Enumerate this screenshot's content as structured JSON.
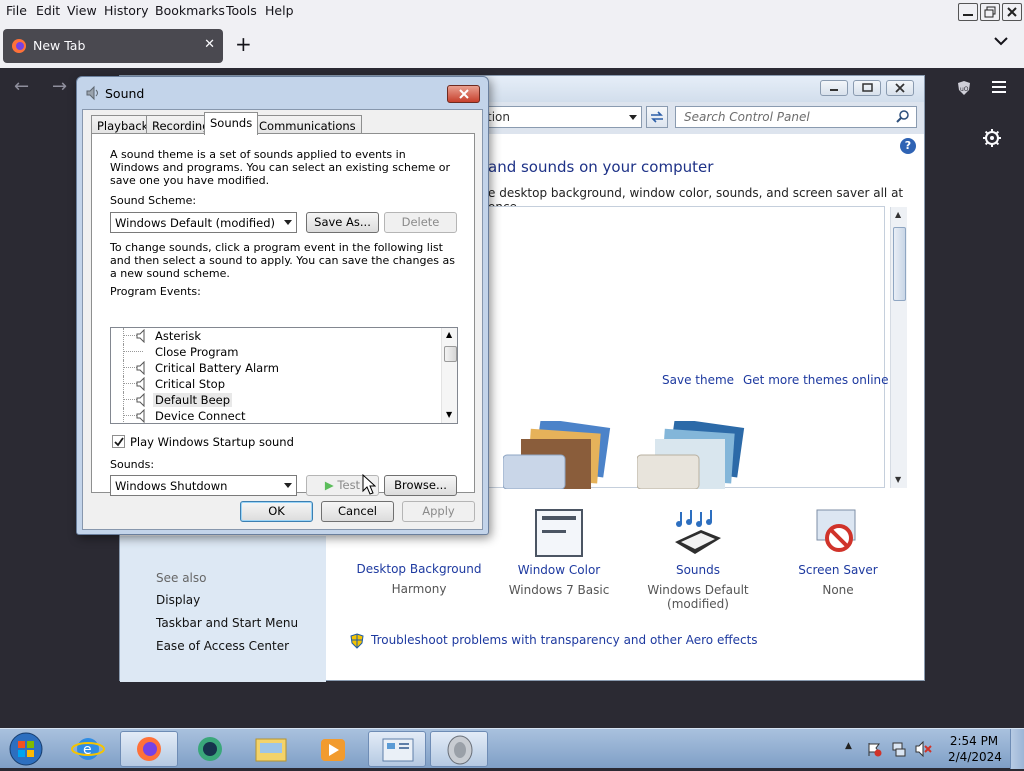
{
  "firefox": {
    "menu": [
      "File",
      "Edit",
      "View",
      "History",
      "Bookmarks",
      "Tools",
      "Help"
    ],
    "tab_label": "New Tab"
  },
  "control_panel": {
    "address_text": "tion",
    "search_placeholder": "Search Control Panel",
    "help_glyph": "?",
    "heading": "and sounds on your computer",
    "description": "e desktop background, window color, sounds, and screen saver all at once.",
    "save_theme": "Save theme",
    "get_more_themes": "Get more themes online",
    "bottom_items": [
      {
        "title": "Desktop Background",
        "sub": "Harmony"
      },
      {
        "title": "Window Color",
        "sub": "Windows 7 Basic"
      },
      {
        "title": "Sounds",
        "sub": "Windows Default (modified)"
      },
      {
        "title": "Screen Saver",
        "sub": "None"
      }
    ],
    "see_also": "See also",
    "sidebar_links": [
      "Display",
      "Taskbar and Start Menu",
      "Ease of Access Center"
    ],
    "troubleshoot": "Troubleshoot problems with transparency and other Aero effects"
  },
  "sound_dialog": {
    "title": "Sound",
    "tabs": [
      "Playback",
      "Recording",
      "Sounds",
      "Communications"
    ],
    "intro": "A sound theme is a set of sounds applied to events in Windows and programs.  You can select an existing scheme or save one you have modified.",
    "scheme_label": "Sound Scheme:",
    "scheme_value": "Windows Default (modified)",
    "save_as": "Save As...",
    "delete": "Delete",
    "change_text": "To change sounds, click a program event in the following list and then select a sound to apply.  You can save the changes as a new sound scheme.",
    "events_label": "Program Events:",
    "events": [
      "Asterisk",
      "Close Program",
      "Critical Battery Alarm",
      "Critical Stop",
      "Default Beep",
      "Device Connect"
    ],
    "startup_label": "Play Windows Startup sound",
    "startup_checked": true,
    "sounds_label": "Sounds:",
    "sound_value": "Windows Shutdown",
    "test": "Test",
    "browse": "Browse...",
    "ok": "OK",
    "cancel": "Cancel",
    "apply": "Apply"
  },
  "taskbar": {
    "time": "2:54 PM",
    "date": "2/4/2024"
  }
}
